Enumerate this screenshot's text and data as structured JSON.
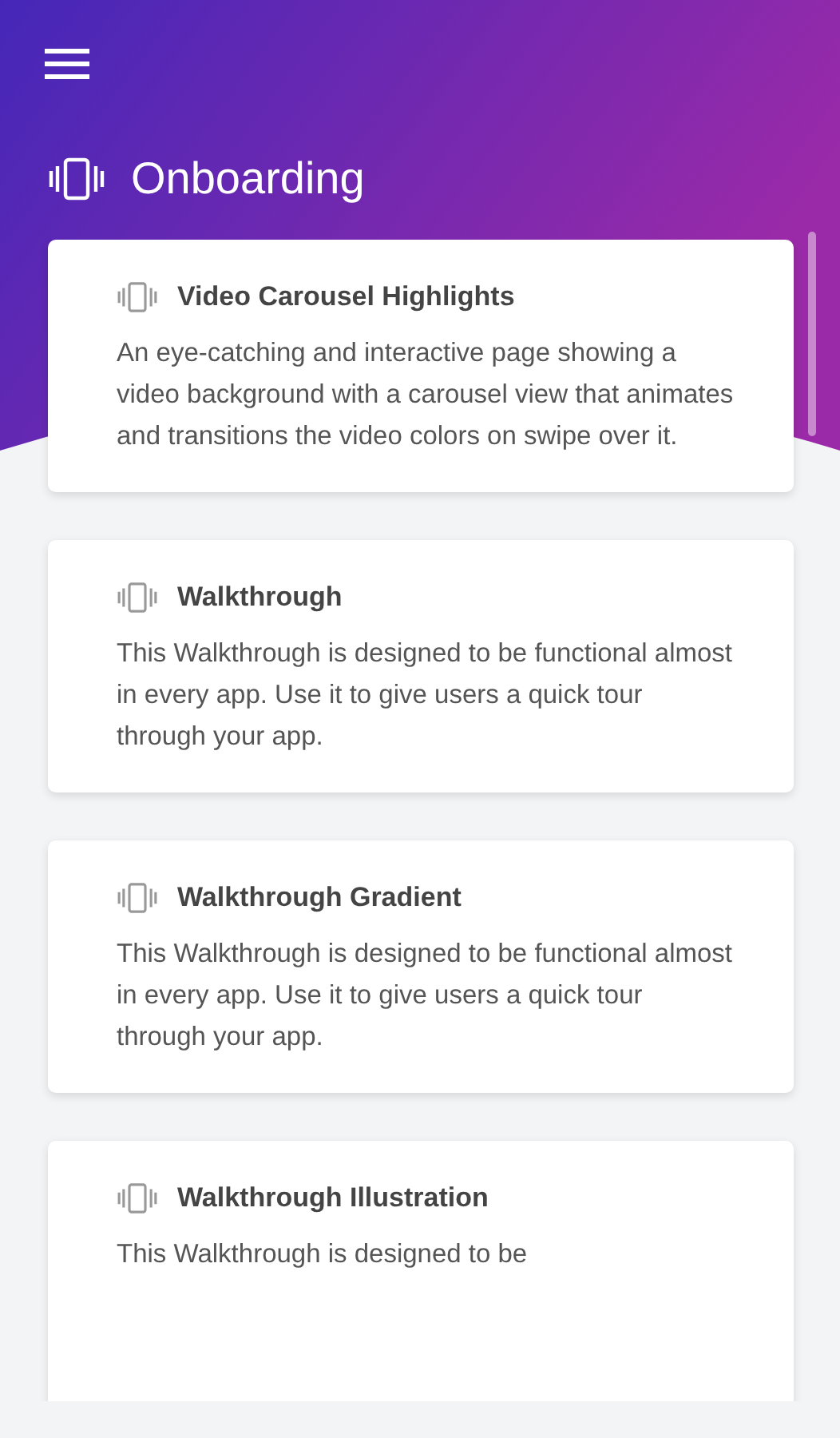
{
  "header": {
    "title": "Onboarding"
  },
  "cards": [
    {
      "title": "Video Carousel Highlights",
      "description": "An eye-catching and interactive page showing a video background with a carousel view that animates and transitions the video colors on swipe over it."
    },
    {
      "title": "Walkthrough",
      "description": "This Walkthrough is designed to be functional almost in every app. Use it to give users a quick tour through your app."
    },
    {
      "title": "Walkthrough Gradient",
      "description": "This Walkthrough is designed to be functional almost in every app. Use it to give users a quick tour through your app."
    },
    {
      "title": "Walkthrough Illustration",
      "description": "This Walkthrough is designed to be"
    }
  ]
}
